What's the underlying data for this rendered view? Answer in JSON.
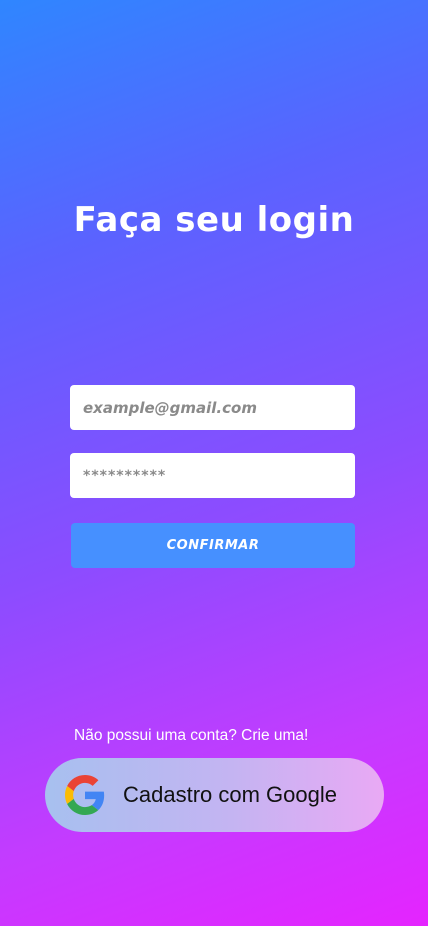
{
  "login": {
    "title": "Faça seu login",
    "email_placeholder": "example@gmail.com",
    "password_value": "**********",
    "confirm_label": "CONFIRMAR"
  },
  "signup": {
    "prompt": "Não possui uma conta? Crie uma!",
    "google_label": "Cadastro com Google"
  },
  "colors": {
    "gradient_start": "#2f86ff",
    "gradient_end": "#e524ff",
    "confirm_button": "#4690ff"
  }
}
